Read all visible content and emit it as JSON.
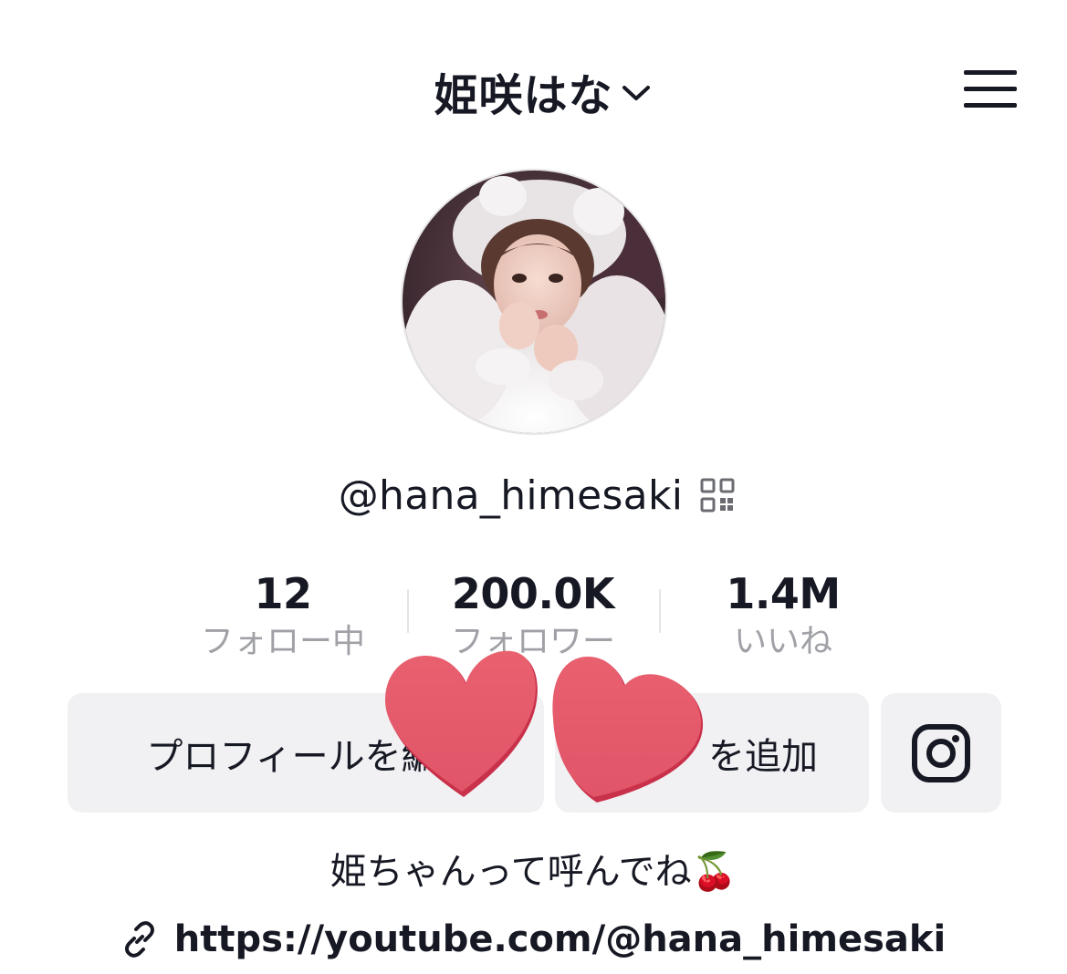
{
  "header": {
    "title": "姫咲はな",
    "title_dropdown_icon": "chevron-down-icon",
    "menu_icon": "hamburger-menu-icon"
  },
  "profile": {
    "avatar": "profile-photo",
    "username": "@hana_himesaki",
    "qr_icon": "qr-code-icon"
  },
  "stats": [
    {
      "value": "12",
      "label": "フォロー中"
    },
    {
      "value": "200.0K",
      "label": "フォロワー"
    },
    {
      "value": "1.4M",
      "label": "いいね"
    }
  ],
  "buttons": {
    "edit_profile": "プロフィールを編",
    "add_friend": "を追加",
    "instagram_icon": "instagram-icon"
  },
  "bio": {
    "text": "姫ちゃんって呼んでね🍒",
    "link_icon": "link-icon",
    "link": "https://youtube.com/@hana_himesaki"
  },
  "colors": {
    "text": "#161823",
    "secondary_text": "#a0a1a6",
    "button_bg": "#f1f1f3",
    "heart": "#e85a6e"
  }
}
